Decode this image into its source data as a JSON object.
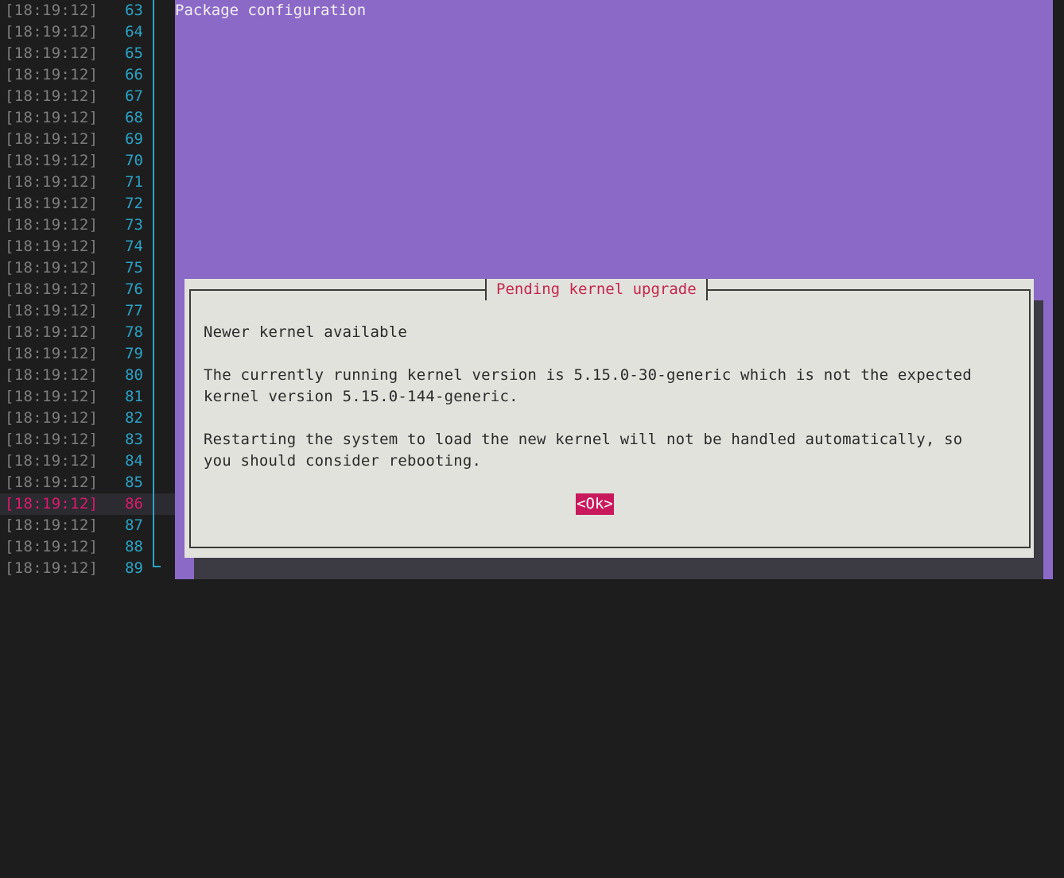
{
  "gutter": {
    "rows": [
      {
        "time": "[18:19:12]",
        "line": "63"
      },
      {
        "time": "[18:19:12]",
        "line": "64"
      },
      {
        "time": "[18:19:12]",
        "line": "65"
      },
      {
        "time": "[18:19:12]",
        "line": "66"
      },
      {
        "time": "[18:19:12]",
        "line": "67"
      },
      {
        "time": "[18:19:12]",
        "line": "68"
      },
      {
        "time": "[18:19:12]",
        "line": "69"
      },
      {
        "time": "[18:19:12]",
        "line": "70"
      },
      {
        "time": "[18:19:12]",
        "line": "71"
      },
      {
        "time": "[18:19:12]",
        "line": "72"
      },
      {
        "time": "[18:19:12]",
        "line": "73"
      },
      {
        "time": "[18:19:12]",
        "line": "74"
      },
      {
        "time": "[18:19:12]",
        "line": "75"
      },
      {
        "time": "[18:19:12]",
        "line": "76"
      },
      {
        "time": "[18:19:12]",
        "line": "77"
      },
      {
        "time": "[18:19:12]",
        "line": "78"
      },
      {
        "time": "[18:19:12]",
        "line": "79"
      },
      {
        "time": "[18:19:12]",
        "line": "80"
      },
      {
        "time": "[18:19:12]",
        "line": "81"
      },
      {
        "time": "[18:19:12]",
        "line": "82"
      },
      {
        "time": "[18:19:12]",
        "line": "83"
      },
      {
        "time": "[18:19:12]",
        "line": "84"
      },
      {
        "time": "[18:19:12]",
        "line": "85"
      },
      {
        "time": "[18:19:12]",
        "line": "86",
        "active": true
      },
      {
        "time": "[18:19:12]",
        "line": "87"
      },
      {
        "time": "[18:19:12]",
        "line": "88"
      },
      {
        "time": "[18:19:12]",
        "line": "89"
      }
    ]
  },
  "terminal": {
    "title": "Package configuration",
    "background_color": "#8b69c7"
  },
  "dialog": {
    "title": "Pending kernel upgrade",
    "heading": "Newer kernel available",
    "paragraph1_line1": "The currently running kernel version is 5.15.0-30-generic which is not the expected",
    "paragraph1_line2": "kernel version 5.15.0-144-generic.",
    "paragraph2_line1": "Restarting the system to load the new kernel will not be handled automatically, so",
    "paragraph2_line2": "you should consider rebooting.",
    "ok_label": "<Ok>"
  },
  "colors": {
    "accent": "#c8195c",
    "line_number": "#2aa3c7",
    "timestamp": "#7d7d7d",
    "dialog_bg": "#e2e2dc"
  }
}
